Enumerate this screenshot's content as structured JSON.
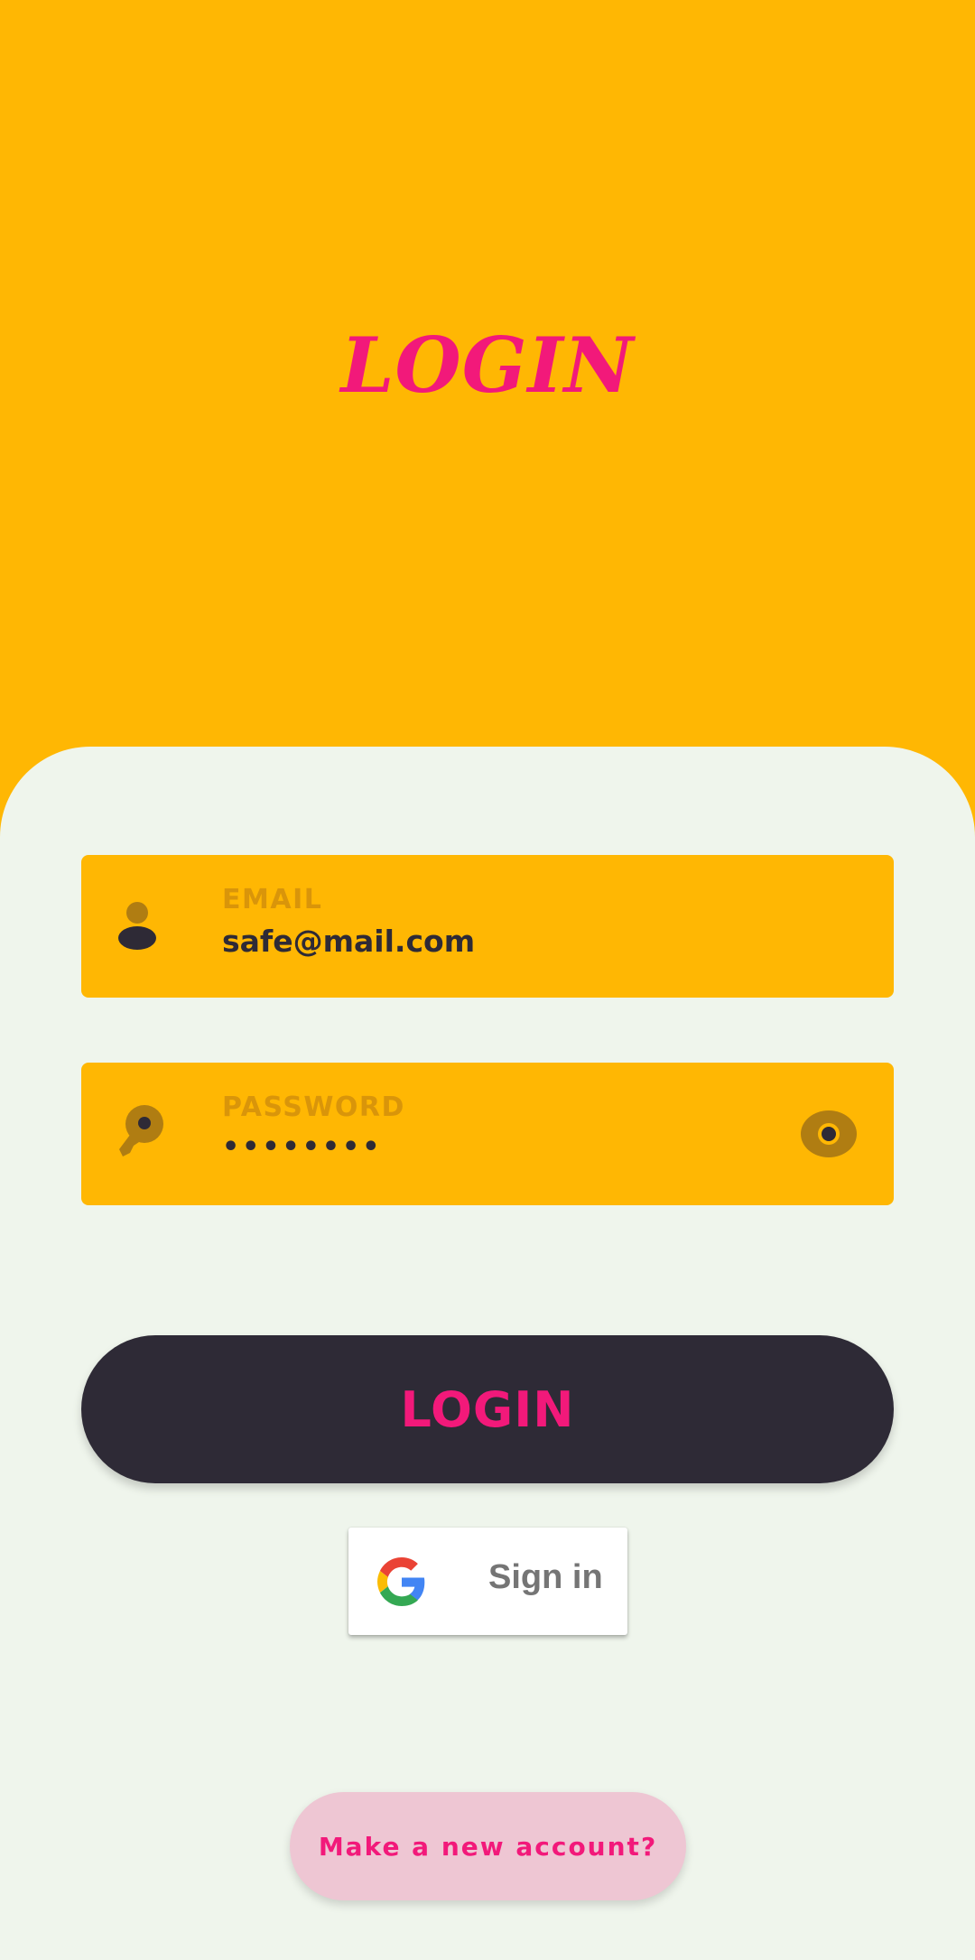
{
  "colors": {
    "accent": "#FFB703",
    "brand_pink": "#F2197A",
    "dark": "#2E2A36",
    "panel_bg": "#EFF5EC",
    "secondary_button_bg": "#EEC6D3"
  },
  "header": {
    "title": "LOGIN"
  },
  "form": {
    "email": {
      "icon": "user-icon",
      "label": "EMAIL",
      "value": "safe@mail.com"
    },
    "password": {
      "icon": "key-icon",
      "label": "PASSWORD",
      "value": "••••••••",
      "toggle_icon": "eye-icon"
    }
  },
  "actions": {
    "login_label": "LOGIN",
    "google_sign_in_label": "Sign in",
    "google_icon": "google-icon",
    "new_account_label": "Make a new account?"
  }
}
